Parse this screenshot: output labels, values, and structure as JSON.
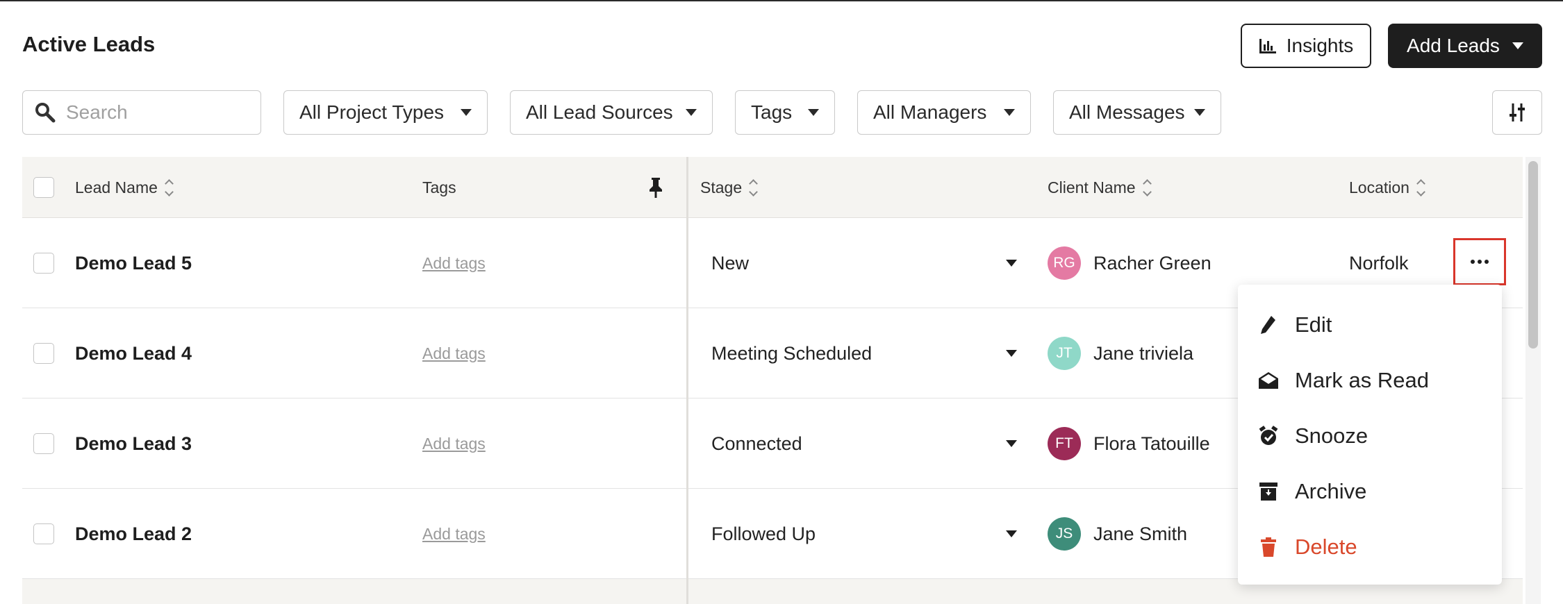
{
  "page": {
    "title": "Active Leads"
  },
  "header": {
    "insights_label": "Insights",
    "add_leads_label": "Add Leads"
  },
  "filters": {
    "search_placeholder": "Search",
    "search_value": "",
    "project_types": "All Project Types",
    "lead_sources": "All Lead Sources",
    "tags": "Tags",
    "managers": "All Managers",
    "messages": "All Messages"
  },
  "table": {
    "columns": {
      "lead_name": "Lead Name",
      "tags": "Tags",
      "stage": "Stage",
      "client_name": "Client Name",
      "location": "Location"
    },
    "rows": [
      {
        "lead": "Demo Lead 5",
        "tags": "Add tags",
        "stage": "New",
        "client_initials": "RG",
        "client": "Racher Green",
        "avatar_color": "#e47aa3",
        "location": "Norfolk"
      },
      {
        "lead": "Demo Lead 4",
        "tags": "Add tags",
        "stage": "Meeting Scheduled",
        "client_initials": "JT",
        "client": "Jane triviela",
        "avatar_color": "#8fd8c8",
        "location": ""
      },
      {
        "lead": "Demo Lead 3",
        "tags": "Add tags",
        "stage": "Connected",
        "client_initials": "FT",
        "client": "Flora Tatouille",
        "avatar_color": "#9c2b57",
        "location": ""
      },
      {
        "lead": "Demo Lead 2",
        "tags": "Add tags",
        "stage": "Followed Up",
        "client_initials": "JS",
        "client": "Jane Smith",
        "avatar_color": "#3e8d7a",
        "location": ""
      }
    ]
  },
  "context_menu": {
    "items": [
      {
        "label": "Edit",
        "icon": "pencil-icon"
      },
      {
        "label": "Mark as Read",
        "icon": "envelope-open-icon"
      },
      {
        "label": "Snooze",
        "icon": "alarm-clock-icon"
      },
      {
        "label": "Archive",
        "icon": "archive-box-icon"
      },
      {
        "label": "Delete",
        "icon": "trash-icon",
        "color": "#d9482b"
      }
    ]
  }
}
